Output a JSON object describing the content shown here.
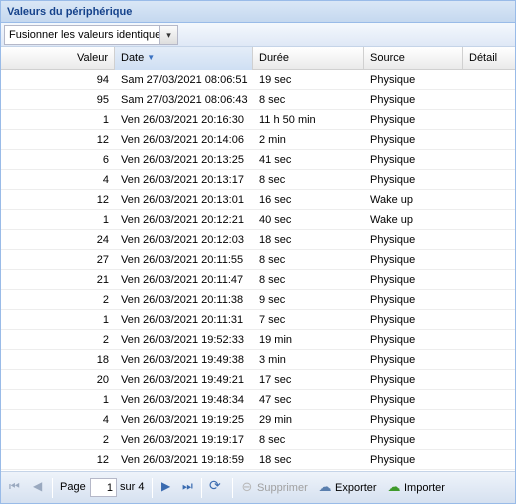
{
  "panel": {
    "title": "Valeurs du périphérique"
  },
  "toolbar": {
    "merge_select": "Fusionner les valeurs identiques",
    "merge_trigger_icon": "chevron-down-icon"
  },
  "columns": {
    "valeur": "Valeur",
    "date": "Date",
    "duree": "Durée",
    "source": "Source",
    "detail": "Détail",
    "sort_icon": "sort-descending-icon"
  },
  "rows": [
    {
      "valeur": "94",
      "date": "Sam 27/03/2021 08:06:51",
      "duree": "19 sec",
      "source": "Physique",
      "detail": ""
    },
    {
      "valeur": "95",
      "date": "Sam 27/03/2021 08:06:43",
      "duree": "8 sec",
      "source": "Physique",
      "detail": ""
    },
    {
      "valeur": "1",
      "date": "Ven 26/03/2021 20:16:30",
      "duree": "11 h 50 min",
      "source": "Physique",
      "detail": ""
    },
    {
      "valeur": "12",
      "date": "Ven 26/03/2021 20:14:06",
      "duree": "2 min",
      "source": "Physique",
      "detail": ""
    },
    {
      "valeur": "6",
      "date": "Ven 26/03/2021 20:13:25",
      "duree": "41 sec",
      "source": "Physique",
      "detail": ""
    },
    {
      "valeur": "4",
      "date": "Ven 26/03/2021 20:13:17",
      "duree": "8 sec",
      "source": "Physique",
      "detail": ""
    },
    {
      "valeur": "12",
      "date": "Ven 26/03/2021 20:13:01",
      "duree": "16 sec",
      "source": "Wake up",
      "detail": ""
    },
    {
      "valeur": "1",
      "date": "Ven 26/03/2021 20:12:21",
      "duree": "40 sec",
      "source": "Wake up",
      "detail": ""
    },
    {
      "valeur": "24",
      "date": "Ven 26/03/2021 20:12:03",
      "duree": "18 sec",
      "source": "Physique",
      "detail": ""
    },
    {
      "valeur": "27",
      "date": "Ven 26/03/2021 20:11:55",
      "duree": "8 sec",
      "source": "Physique",
      "detail": ""
    },
    {
      "valeur": "21",
      "date": "Ven 26/03/2021 20:11:47",
      "duree": "8 sec",
      "source": "Physique",
      "detail": ""
    },
    {
      "valeur": "2",
      "date": "Ven 26/03/2021 20:11:38",
      "duree": "9 sec",
      "source": "Physique",
      "detail": ""
    },
    {
      "valeur": "1",
      "date": "Ven 26/03/2021 20:11:31",
      "duree": "7 sec",
      "source": "Physique",
      "detail": ""
    },
    {
      "valeur": "2",
      "date": "Ven 26/03/2021 19:52:33",
      "duree": "19 min",
      "source": "Physique",
      "detail": ""
    },
    {
      "valeur": "18",
      "date": "Ven 26/03/2021 19:49:38",
      "duree": "3 min",
      "source": "Physique",
      "detail": ""
    },
    {
      "valeur": "20",
      "date": "Ven 26/03/2021 19:49:21",
      "duree": "17 sec",
      "source": "Physique",
      "detail": ""
    },
    {
      "valeur": "1",
      "date": "Ven 26/03/2021 19:48:34",
      "duree": "47 sec",
      "source": "Physique",
      "detail": ""
    },
    {
      "valeur": "4",
      "date": "Ven 26/03/2021 19:19:25",
      "duree": "29 min",
      "source": "Physique",
      "detail": ""
    },
    {
      "valeur": "2",
      "date": "Ven 26/03/2021 19:19:17",
      "duree": "8 sec",
      "source": "Physique",
      "detail": ""
    },
    {
      "valeur": "12",
      "date": "Ven 26/03/2021 19:18:59",
      "duree": "18 sec",
      "source": "Physique",
      "detail": ""
    }
  ],
  "pager": {
    "first_icon": "first-page-icon",
    "prev_icon": "previous-page-icon",
    "page_label": "Page",
    "page_value": "1",
    "of_label": "sur 4",
    "next_icon": "next-page-icon",
    "last_icon": "last-page-icon",
    "refresh_icon": "refresh-icon",
    "delete_label": "Supprimer",
    "delete_icon": "minus-circle-icon",
    "export_label": "Exporter",
    "export_icon": "cloud-download-icon",
    "import_label": "Importer",
    "import_icon": "cloud-upload-icon"
  },
  "colors": {
    "header_text": "#15428b",
    "sort_accent": "#3b72c1",
    "import_green": "#3e9a2b"
  }
}
